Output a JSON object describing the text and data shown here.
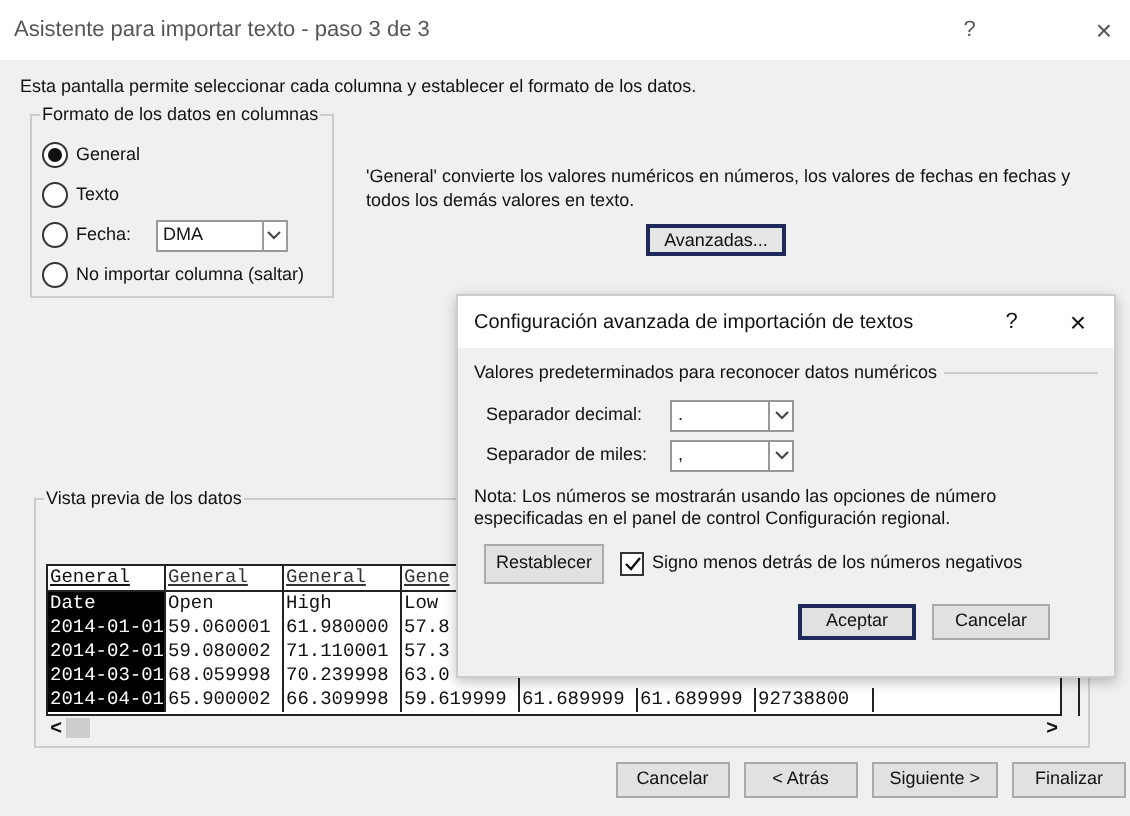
{
  "window": {
    "title": "Asistente para importar texto - paso 3 de 3",
    "help": "?",
    "close": "×"
  },
  "instruction": "Esta pantalla permite seleccionar cada columna y establecer el formato de los datos.",
  "format_group": {
    "title": "Formato de los datos en columnas",
    "options": [
      {
        "label": "General",
        "selected": true,
        "kind": "plain"
      },
      {
        "label": "Texto",
        "selected": false,
        "kind": "plain"
      },
      {
        "label": "Fecha:",
        "selected": false,
        "kind": "date",
        "value": "DMA"
      },
      {
        "label": "No importar columna (saltar)",
        "selected": false,
        "kind": "plain"
      }
    ]
  },
  "description": "'General' convierte los valores numéricos en números, los valores de fechas en fechas y todos los demás valores en texto.",
  "advanced_button": "Avanzadas...",
  "preview": {
    "title": "Vista previa de los datos",
    "columns": [
      {
        "header": "General",
        "selected": true
      },
      {
        "header": "General",
        "selected": false
      },
      {
        "header": "General",
        "selected": false
      },
      {
        "header": "Gene",
        "selected": false
      }
    ],
    "rows": [
      [
        "Date",
        "Open",
        "High",
        "Low"
      ],
      [
        "2014-01-01",
        "59.060001",
        "61.980000",
        "57.8"
      ],
      [
        "2014-02-01",
        "59.080002",
        "71.110001",
        "57.3"
      ],
      [
        "2014-03-01",
        "68.059998",
        "70.239998",
        "63.0"
      ],
      [
        "2014-04-01",
        "65.900002",
        "66.309998",
        "59.619999",
        "61.689999",
        "61.689999",
        "92738800"
      ]
    ],
    "scroll_left": "<",
    "scroll_right": ">"
  },
  "buttons": [
    {
      "label": "Cancelar"
    },
    {
      "label": "< Atrás"
    },
    {
      "label": "Siguiente >"
    },
    {
      "label": "Finalizar"
    }
  ],
  "dialog": {
    "title": "Configuración avanzada de importación de textos",
    "help": "?",
    "close": "×",
    "group_title": "Valores predeterminados para reconocer datos numéricos",
    "fields": [
      {
        "label": "Separador decimal:",
        "value": "."
      },
      {
        "label": "Separador de miles:",
        "value": ","
      }
    ],
    "note": "Nota: Los números se mostrarán usando las opciones de número especificadas en el panel de control Configuración regional.",
    "reset_button": "Restablecer",
    "checkbox": {
      "label": "Signo menos detrás de los números negativos",
      "checked": true
    },
    "buttons": [
      {
        "label": "Aceptar",
        "default": true
      },
      {
        "label": "Cancelar",
        "default": false
      }
    ]
  }
}
